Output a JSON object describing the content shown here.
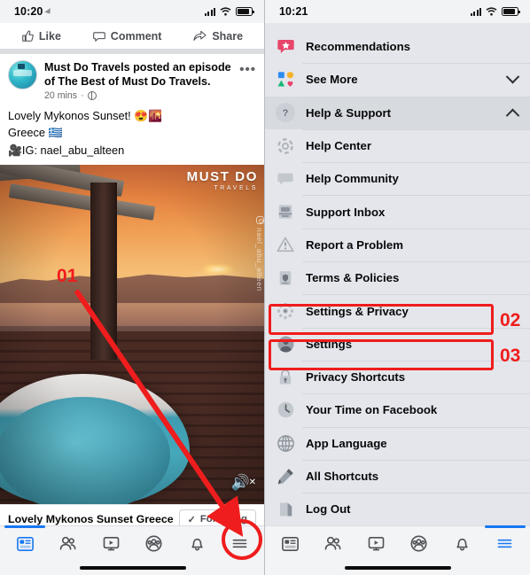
{
  "left": {
    "status": {
      "time": "10:20",
      "location_icon": "location-arrow-icon",
      "signal_icon": "cellular-signal-icon",
      "wifi_icon": "wifi-icon",
      "battery_icon": "battery-icon"
    },
    "action_bar": [
      {
        "icon": "thumbs-up-icon",
        "label": "Like"
      },
      {
        "icon": "comment-bubble-icon",
        "label": "Comment"
      },
      {
        "icon": "share-arrow-icon",
        "label": "Share"
      }
    ],
    "post": {
      "avatar": "page-avatar",
      "title": "Must Do Travels posted an episode of The Best of Must Do Travels.",
      "timestamp": "20 mins",
      "privacy_icon": "globe-icon",
      "more_icon": "more-options-icon",
      "body_lines": [
        "Lovely Mykonos Sunset! 😍🌇",
        "Greece 🇬🇷",
        "🎥IG: nael_abu_alteen"
      ]
    },
    "video": {
      "watermark_main": "MUST DO",
      "watermark_sub": "TRAVELS",
      "ig_handle": "nael_abu_alteen",
      "ig_icon": "instagram-icon",
      "mute_icon": "speaker-muted-icon"
    },
    "video_title": "Lovely Mykonos Sunset Greece",
    "follow_button": {
      "label": "Following",
      "check_icon": "check-icon"
    },
    "bottom_nav": [
      {
        "name": "news-feed",
        "icon": "news-feed-icon",
        "active": true
      },
      {
        "name": "friends",
        "icon": "friends-icon",
        "active": false
      },
      {
        "name": "watch",
        "icon": "watch-video-icon",
        "active": false
      },
      {
        "name": "groups",
        "icon": "groups-icon",
        "active": false
      },
      {
        "name": "notifications",
        "icon": "bell-icon",
        "active": false
      },
      {
        "name": "menu",
        "icon": "hamburger-menu-icon",
        "active": false
      }
    ]
  },
  "right": {
    "status": {
      "time": "10:21",
      "signal_icon": "cellular-signal-icon",
      "wifi_icon": "wifi-icon",
      "battery_icon": "battery-icon"
    },
    "menu": [
      {
        "label": "Recommendations",
        "icon": "recommendations-icon",
        "trailing": "",
        "highlight": false
      },
      {
        "label": "See More",
        "icon": "see-more-icon",
        "trailing": "chevron-down",
        "highlight": false
      },
      {
        "label": "Help & Support",
        "icon": "question-mark-icon",
        "trailing": "chevron-up",
        "highlight": true
      },
      {
        "label": "Help Center",
        "icon": "lifebuoy-icon",
        "trailing": "",
        "highlight": false
      },
      {
        "label": "Help Community",
        "icon": "chat-bubble-icon",
        "trailing": "",
        "highlight": false
      },
      {
        "label": "Support Inbox",
        "icon": "inbox-tray-icon",
        "trailing": "",
        "highlight": false
      },
      {
        "label": "Report a Problem",
        "icon": "warning-triangle-icon",
        "trailing": "",
        "highlight": false
      },
      {
        "label": "Terms & Policies",
        "icon": "document-shield-icon",
        "trailing": "",
        "highlight": false
      },
      {
        "label": "Settings & Privacy",
        "icon": "gear-icon",
        "trailing": "",
        "highlight": false
      },
      {
        "label": "Settings",
        "icon": "account-circle-icon",
        "trailing": "",
        "highlight": false
      },
      {
        "label": "Privacy Shortcuts",
        "icon": "lock-icon",
        "trailing": "",
        "highlight": false
      },
      {
        "label": "Your Time on Facebook",
        "icon": "clock-icon",
        "trailing": "",
        "highlight": false
      },
      {
        "label": "App Language",
        "icon": "globe-icon",
        "trailing": "",
        "highlight": false
      },
      {
        "label": "All Shortcuts",
        "icon": "pencil-icon",
        "trailing": "",
        "highlight": false
      },
      {
        "label": "Log Out",
        "icon": "logout-icon",
        "trailing": "",
        "highlight": false
      }
    ],
    "bottom_nav": [
      {
        "name": "news-feed",
        "icon": "news-feed-icon",
        "active": false
      },
      {
        "name": "friends",
        "icon": "friends-icon",
        "active": false
      },
      {
        "name": "watch",
        "icon": "watch-video-icon",
        "active": false
      },
      {
        "name": "groups",
        "icon": "groups-icon",
        "active": false
      },
      {
        "name": "notifications",
        "icon": "bell-icon",
        "active": false
      },
      {
        "name": "menu",
        "icon": "hamburger-menu-icon",
        "active": true
      }
    ]
  },
  "annotations": {
    "color": "#ef1d1d",
    "step_01": "01",
    "step_02": "02",
    "step_03": "03"
  }
}
